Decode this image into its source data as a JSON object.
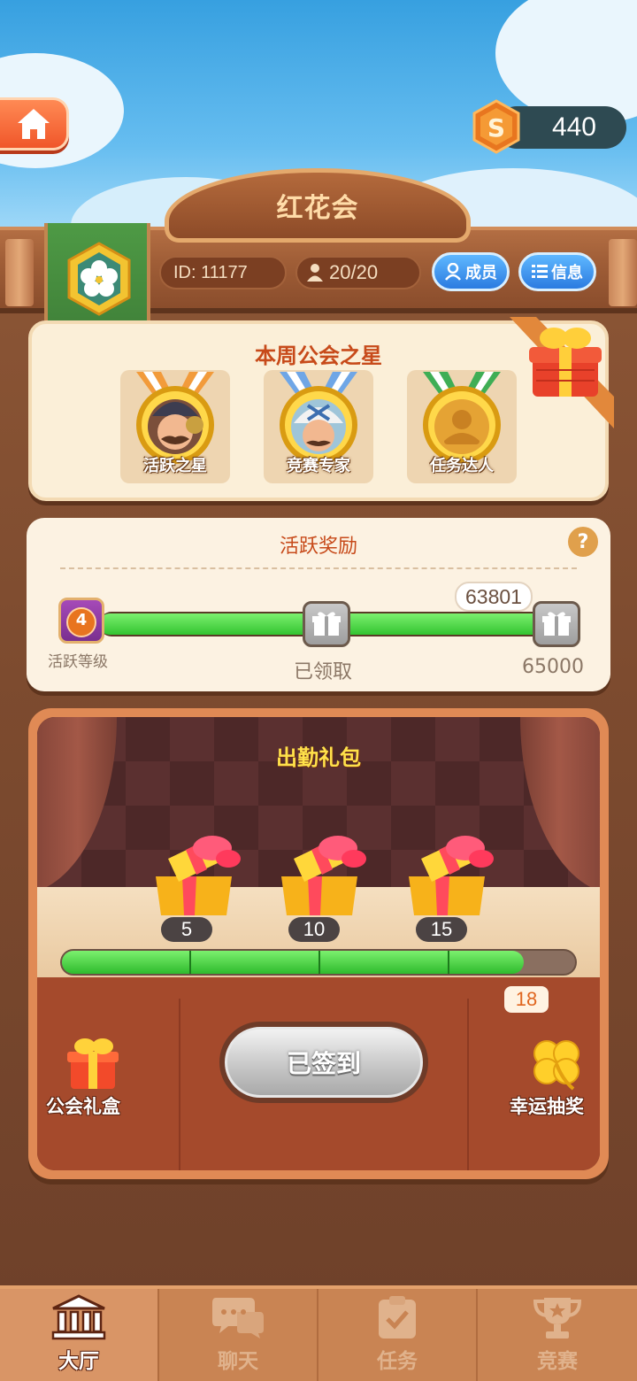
{
  "header": {
    "coins": "440",
    "guild_name": "红花会",
    "guild_id_label": "ID:  11177",
    "member_count": "20/20",
    "members_button": "成员",
    "info_button": "信息"
  },
  "weekly_stars": {
    "title": "本周公会之星",
    "medals": [
      {
        "label": "活跃之星",
        "icon": "explorer-avatar",
        "ribbon": "orange"
      },
      {
        "label": "竞赛专家",
        "icon": "mechanic-avatar",
        "ribbon": "blue"
      },
      {
        "label": "任务达人",
        "icon": "person-placeholder",
        "ribbon": "green"
      }
    ]
  },
  "activity_reward": {
    "title": "活跃奖励",
    "help": "?",
    "level": "4",
    "level_label": "活跃等级",
    "current_points": "63801",
    "claimed_label": "已领取",
    "target": "65000",
    "progress": 0.98
  },
  "attendance": {
    "title": "出勤礼包",
    "milestones": [
      "5",
      "10",
      "15"
    ],
    "current": "18",
    "progress": 0.9,
    "checkin_button": "已签到",
    "left_action": "公会礼盒",
    "right_action": "幸运抽奖"
  },
  "nav": {
    "items": [
      {
        "label": "大厅",
        "icon": "hall-icon",
        "active": true
      },
      {
        "label": "聊天",
        "icon": "chat-icon",
        "active": false
      },
      {
        "label": "任务",
        "icon": "task-icon",
        "active": false
      },
      {
        "label": "竞赛",
        "icon": "trophy-icon",
        "active": false
      }
    ]
  },
  "colors": {
    "accent": "#c74a1a",
    "progress_green": "#33c431",
    "title_yellow": "#ffe14a"
  }
}
